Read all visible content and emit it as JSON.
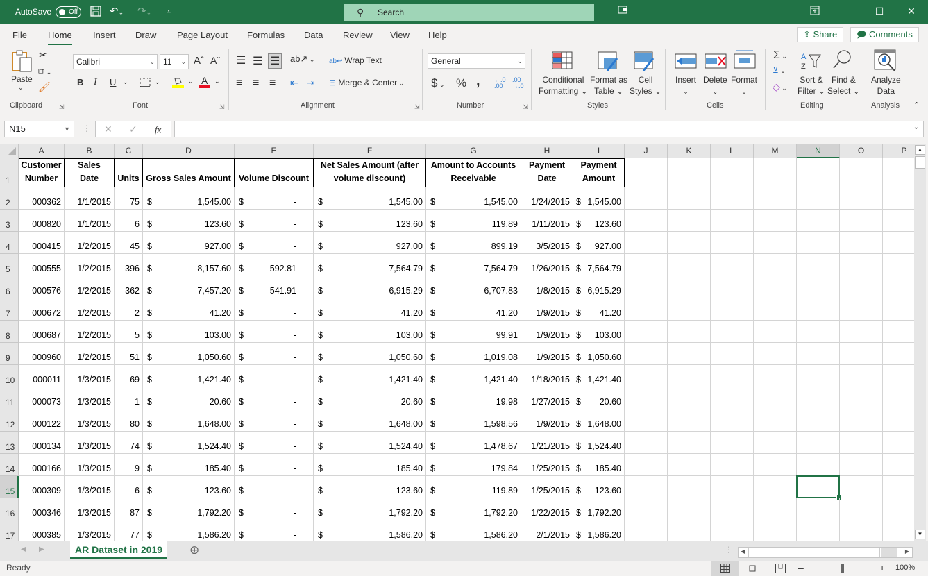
{
  "titlebar": {
    "autosave_label": "AutoSave",
    "autosave_state": "Off",
    "search_placeholder": "Search",
    "brand_color": "#217346"
  },
  "tabs": [
    "File",
    "Home",
    "Insert",
    "Draw",
    "Page Layout",
    "Formulas",
    "Data",
    "Review",
    "View",
    "Help"
  ],
  "active_tab": "Home",
  "share_label": "Share",
  "comments_label": "Comments",
  "ribbon": {
    "clipboard": {
      "paste": "Paste",
      "label": "Clipboard"
    },
    "font": {
      "name": "Calibri",
      "size": "11",
      "bold": "B",
      "italic": "I",
      "underline": "U",
      "label": "Font"
    },
    "alignment": {
      "wrap": "Wrap Text",
      "merge": "Merge & Center",
      "label": "Alignment"
    },
    "number": {
      "format": "General",
      "currency": "$",
      "percent": "%",
      "comma": ",",
      "label": "Number"
    },
    "styles": {
      "conditional1": "Conditional",
      "conditional2": "Formatting",
      "table1": "Format as",
      "table2": "Table",
      "cell1": "Cell",
      "cell2": "Styles",
      "label": "Styles"
    },
    "cells": {
      "insert": "Insert",
      "delete": "Delete",
      "format": "Format",
      "label": "Cells"
    },
    "editing": {
      "sort1": "Sort &",
      "sort2": "Filter",
      "find1": "Find &",
      "find2": "Select",
      "label": "Editing"
    },
    "analysis": {
      "analyze1": "Analyze",
      "analyze2": "Data",
      "label": "Analysis"
    }
  },
  "formula_bar": {
    "name_box": "N15",
    "formula": "",
    "fx": "fx"
  },
  "columns": [
    "A",
    "B",
    "C",
    "D",
    "E",
    "F",
    "G",
    "H",
    "I",
    "J",
    "K",
    "L",
    "M",
    "N",
    "O",
    "P"
  ],
  "selected_cell": "N15",
  "headers": [
    "Customer Number",
    "Sales Date",
    "Units",
    "Gross Sales Amount",
    "Volume Discount",
    "Net Sales Amount (after volume discount)",
    "Amount to Accounts Receivable",
    "Payment Date",
    "Payment Amount"
  ],
  "rows": [
    {
      "n": "2",
      "cust": "000362",
      "date": "1/1/2015",
      "units": "75",
      "gross": "1,545.00",
      "disc": "-",
      "net": "1,545.00",
      "ar": "1,545.00",
      "pdate": "1/24/2015",
      "pamt": "$1,545.00"
    },
    {
      "n": "3",
      "cust": "000820",
      "date": "1/1/2015",
      "units": "6",
      "gross": "123.60",
      "disc": "-",
      "net": "123.60",
      "ar": "119.89",
      "pdate": "1/11/2015",
      "pamt": "$   123.60"
    },
    {
      "n": "4",
      "cust": "000415",
      "date": "1/2/2015",
      "units": "45",
      "gross": "927.00",
      "disc": "-",
      "net": "927.00",
      "ar": "899.19",
      "pdate": "3/5/2015",
      "pamt": "$   927.00"
    },
    {
      "n": "5",
      "cust": "000555",
      "date": "1/2/2015",
      "units": "396",
      "gross": "8,157.60",
      "disc": "592.81",
      "net": "7,564.79",
      "ar": "7,564.79",
      "pdate": "1/26/2015",
      "pamt": "$7,564.79"
    },
    {
      "n": "6",
      "cust": "000576",
      "date": "1/2/2015",
      "units": "362",
      "gross": "7,457.20",
      "disc": "541.91",
      "net": "6,915.29",
      "ar": "6,707.83",
      "pdate": "1/8/2015",
      "pamt": "$6,915.29"
    },
    {
      "n": "7",
      "cust": "000672",
      "date": "1/2/2015",
      "units": "2",
      "gross": "41.20",
      "disc": "-",
      "net": "41.20",
      "ar": "41.20",
      "pdate": "1/9/2015",
      "pamt": "$     41.20"
    },
    {
      "n": "8",
      "cust": "000687",
      "date": "1/2/2015",
      "units": "5",
      "gross": "103.00",
      "disc": "-",
      "net": "103.00",
      "ar": "99.91",
      "pdate": "1/9/2015",
      "pamt": "$   103.00"
    },
    {
      "n": "9",
      "cust": "000960",
      "date": "1/2/2015",
      "units": "51",
      "gross": "1,050.60",
      "disc": "-",
      "net": "1,050.60",
      "ar": "1,019.08",
      "pdate": "1/9/2015",
      "pamt": "$1,050.60"
    },
    {
      "n": "10",
      "cust": "000011",
      "date": "1/3/2015",
      "units": "69",
      "gross": "1,421.40",
      "disc": "-",
      "net": "1,421.40",
      "ar": "1,421.40",
      "pdate": "1/18/2015",
      "pamt": "$1,421.40"
    },
    {
      "n": "11",
      "cust": "000073",
      "date": "1/3/2015",
      "units": "1",
      "gross": "20.60",
      "disc": "-",
      "net": "20.60",
      "ar": "19.98",
      "pdate": "1/27/2015",
      "pamt": "$     20.60"
    },
    {
      "n": "12",
      "cust": "000122",
      "date": "1/3/2015",
      "units": "80",
      "gross": "1,648.00",
      "disc": "-",
      "net": "1,648.00",
      "ar": "1,598.56",
      "pdate": "1/9/2015",
      "pamt": "$1,648.00"
    },
    {
      "n": "13",
      "cust": "000134",
      "date": "1/3/2015",
      "units": "74",
      "gross": "1,524.40",
      "disc": "-",
      "net": "1,524.40",
      "ar": "1,478.67",
      "pdate": "1/21/2015",
      "pamt": "$1,524.40"
    },
    {
      "n": "14",
      "cust": "000166",
      "date": "1/3/2015",
      "units": "9",
      "gross": "185.40",
      "disc": "-",
      "net": "185.40",
      "ar": "179.84",
      "pdate": "1/25/2015",
      "pamt": "$   185.40"
    },
    {
      "n": "15",
      "cust": "000309",
      "date": "1/3/2015",
      "units": "6",
      "gross": "123.60",
      "disc": "-",
      "net": "123.60",
      "ar": "119.89",
      "pdate": "1/25/2015",
      "pamt": "$   123.60"
    },
    {
      "n": "16",
      "cust": "000346",
      "date": "1/3/2015",
      "units": "87",
      "gross": "1,792.20",
      "disc": "-",
      "net": "1,792.20",
      "ar": "1,792.20",
      "pdate": "1/22/2015",
      "pamt": "$1,792.20"
    },
    {
      "n": "17",
      "cust": "000385",
      "date": "1/3/2015",
      "units": "77",
      "gross": "1,586.20",
      "disc": "-",
      "net": "1,586.20",
      "ar": "1,586.20",
      "pdate": "2/1/2015",
      "pamt": "$1,586.20"
    }
  ],
  "currency_symbol": "$",
  "sheet_tab": "AR Dataset in 2019",
  "status": {
    "text": "Ready",
    "zoom": "100%",
    "zoom_level_percent": 100
  }
}
